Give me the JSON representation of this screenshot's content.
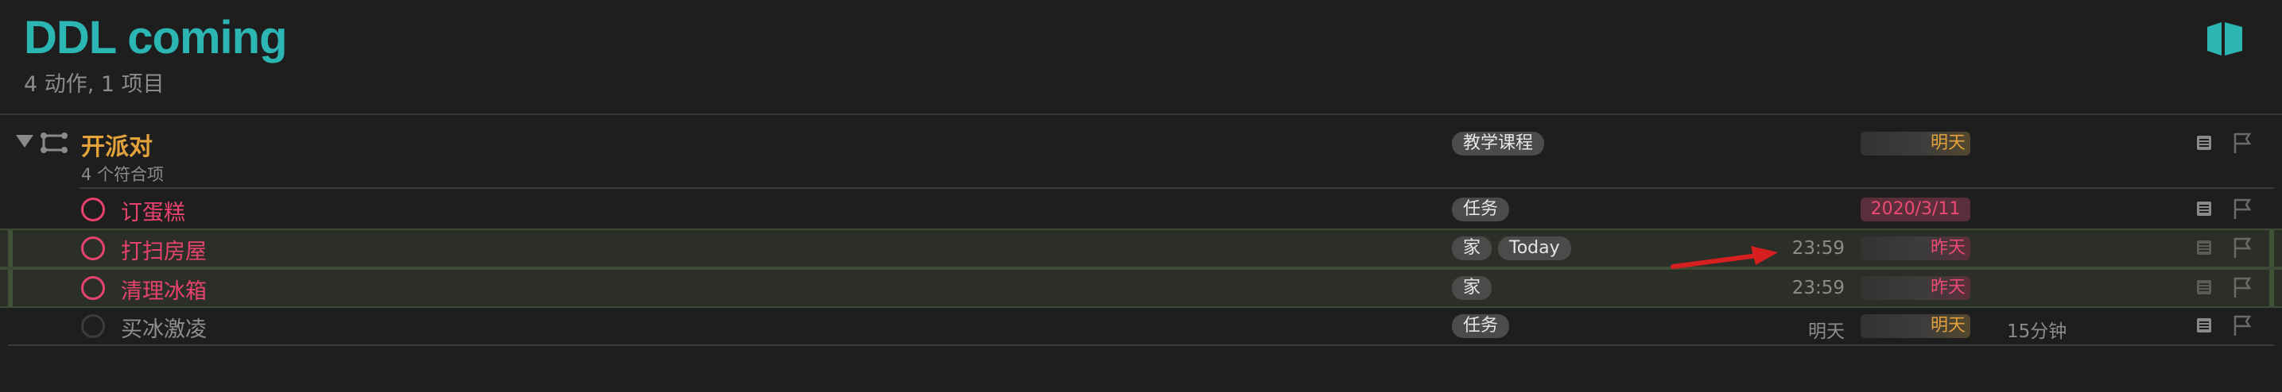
{
  "header": {
    "title": "DDL coming",
    "subtitle": "4 动作, 1 项目"
  },
  "project": {
    "title": "开派对",
    "subtitle": "4 个符合项",
    "tag": "教学课程",
    "due": "明天"
  },
  "tasks": [
    {
      "title": "订蛋糕",
      "tags": [
        "任务"
      ],
      "defer": "",
      "due": "2020/3/11",
      "duration": ""
    },
    {
      "title": "打扫房屋",
      "tags": [
        "家",
        "Today"
      ],
      "defer": "23:59",
      "due": "昨天",
      "duration": ""
    },
    {
      "title": "清理冰箱",
      "tags": [
        "家"
      ],
      "defer": "23:59",
      "due": "昨天",
      "duration": ""
    },
    {
      "title": "买冰激凌",
      "tags": [
        "任务"
      ],
      "defer": "明天",
      "due": "明天",
      "duration": "15分钟"
    }
  ],
  "colors": {
    "title": "#2bb5b3",
    "project": "#e4a23b",
    "overdue": "#e8436e",
    "annotation_arrow": "#d62020"
  },
  "icons": {
    "inspector": "sidebar-inspector-icon",
    "project": "project-icon",
    "note": "note-icon",
    "flag": "flag-icon",
    "arrow": "red-arrow-annotation"
  }
}
